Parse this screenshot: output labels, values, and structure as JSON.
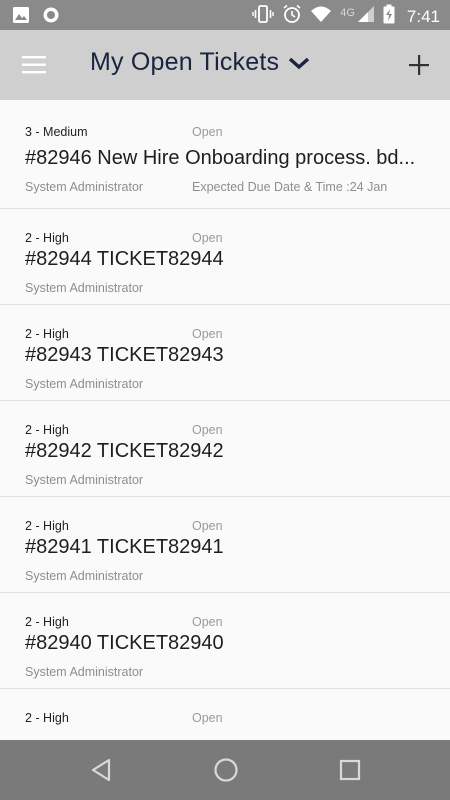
{
  "status_bar": {
    "time": "7:41",
    "network": "4G",
    "icons": [
      "image-icon",
      "circle-app-icon",
      "vibrate-icon",
      "alarm-icon",
      "wifi-icon",
      "signal-icon",
      "battery-charging-icon"
    ]
  },
  "app_bar": {
    "title": "My Open Tickets",
    "icons": [
      "menu-icon",
      "chevron-down-icon",
      "plus-icon"
    ]
  },
  "tickets": [
    {
      "priority": "3 - Medium",
      "status": "Open",
      "title": "#82946 New Hire Onboarding process. bd...",
      "owner": "System Administrator",
      "due": "Expected Due Date & Time :24 Jan"
    },
    {
      "priority": "2 - High",
      "status": "Open",
      "title": "#82944 TICKET82944",
      "owner": "System Administrator"
    },
    {
      "priority": "2 - High",
      "status": "Open",
      "title": "#82943 TICKET82943",
      "owner": "System Administrator"
    },
    {
      "priority": "2 - High",
      "status": "Open",
      "title": "#82942 TICKET82942",
      "owner": "System Administrator"
    },
    {
      "priority": "2 - High",
      "status": "Open",
      "title": "#82941 TICKET82941",
      "owner": "System Administrator"
    },
    {
      "priority": "2 - High",
      "status": "Open",
      "title": "#82940 TICKET82940",
      "owner": "System Administrator"
    },
    {
      "priority": "2 - High",
      "status": "Open",
      "title": "",
      "owner": ""
    }
  ],
  "nav_bar": {
    "icons": [
      "back-triangle-icon",
      "home-circle-icon",
      "recents-square-icon"
    ]
  },
  "colors": {
    "status_bar": "#8a8a8a",
    "app_bar": "#cfcfcf",
    "title_text": "#1a2340",
    "nav_bar": "#7a7a7a",
    "list_bg": "#fafafa"
  }
}
